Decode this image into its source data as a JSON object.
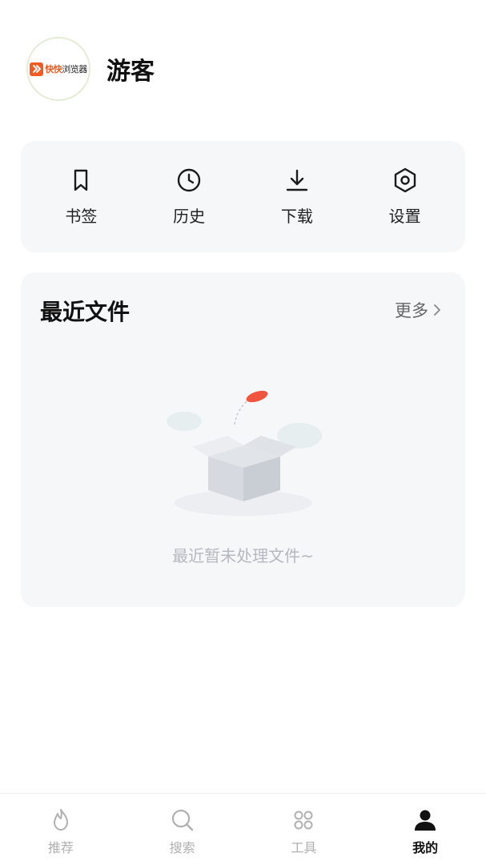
{
  "profile": {
    "logo_text_a": "快快",
    "logo_text_b": "浏览器",
    "username": "游客"
  },
  "quick_actions": [
    {
      "label": "书签",
      "icon": "bookmark-icon"
    },
    {
      "label": "历史",
      "icon": "clock-icon"
    },
    {
      "label": "下载",
      "icon": "download-icon"
    },
    {
      "label": "设置",
      "icon": "settings-icon"
    }
  ],
  "recent_files": {
    "title": "最近文件",
    "more_label": "更多",
    "empty_text": "最近暂未处理文件~",
    "accent_color": "#f0553f"
  },
  "tabbar": {
    "tabs": [
      {
        "label": "推荐",
        "icon": "flame-icon",
        "active": false
      },
      {
        "label": "搜索",
        "icon": "search-icon",
        "active": false
      },
      {
        "label": "工具",
        "icon": "grid-icon",
        "active": false
      },
      {
        "label": "我的",
        "icon": "user-icon",
        "active": true
      }
    ]
  },
  "colors": {
    "brand": "#f25a1f",
    "card_bg": "#f6f7f9",
    "inactive_tab": "#b0b0b0",
    "active_tab": "#111111"
  }
}
